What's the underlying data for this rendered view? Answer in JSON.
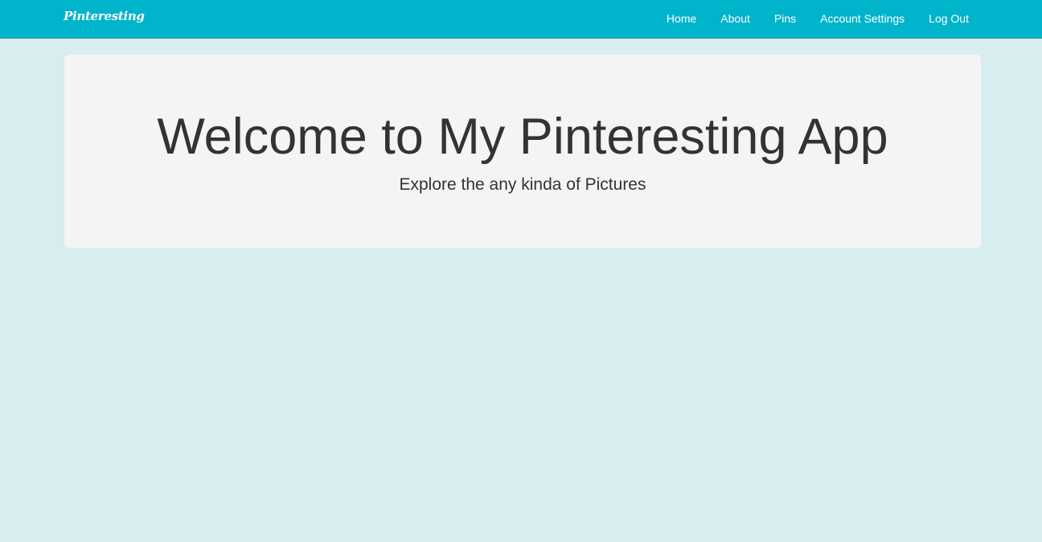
{
  "navbar": {
    "brand": "Pinteresting",
    "links": [
      {
        "label": "Home"
      },
      {
        "label": "About"
      },
      {
        "label": "Pins"
      },
      {
        "label": "Account Settings"
      },
      {
        "label": "Log Out"
      }
    ]
  },
  "jumbotron": {
    "title": "Welcome to My Pinteresting App",
    "subtitle": "Explore the any kinda of Pictures"
  },
  "colors": {
    "navbar_bg": "#00b4cb",
    "page_bg": "#d8edf0",
    "jumbotron_bg": "#f4f4f4",
    "text": "#333333"
  }
}
